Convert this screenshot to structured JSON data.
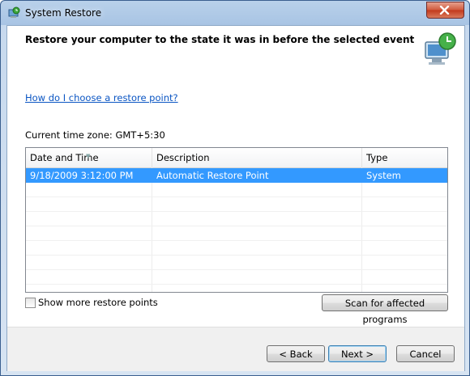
{
  "window": {
    "title": "System Restore"
  },
  "header": {
    "heading": "Restore your computer to the state it was in before the selected event"
  },
  "help_link": "How do I choose a restore point?",
  "timezone": "Current time zone: GMT+5:30",
  "table": {
    "columns": [
      "Date and Time",
      "Description",
      "Type"
    ],
    "rows": [
      {
        "date": "9/18/2009 3:12:00 PM",
        "description": "Automatic Restore Point",
        "type": "System",
        "selected": true
      }
    ]
  },
  "show_more": {
    "label": "Show more restore points",
    "checked": false
  },
  "buttons": {
    "scan": "Scan for affected programs",
    "back": "< Back",
    "next": "Next >",
    "cancel": "Cancel"
  },
  "colors": {
    "selection": "#3399ff",
    "link": "#0a55c3"
  }
}
